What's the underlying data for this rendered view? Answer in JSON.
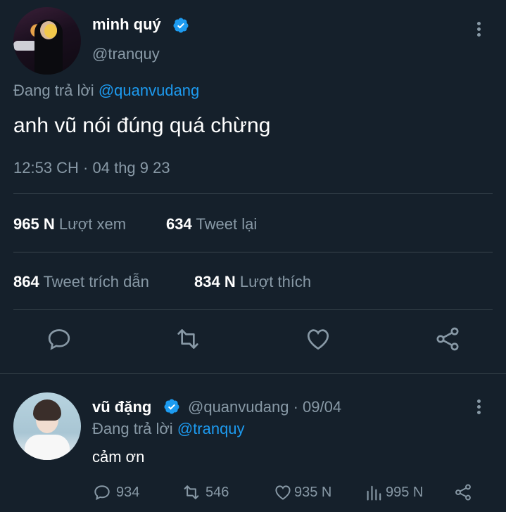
{
  "main_tweet": {
    "author_name": "minh quý",
    "author_handle": "@tranquy",
    "reply_prefix": "Đang trả lời",
    "reply_to": "@quanvudang",
    "text": "anh vũ nói đúng quá chừng",
    "timestamp": "12:53 CH · 04 thg 9 23",
    "stats": {
      "views_value": "965 N",
      "views_label": "Lượt xem",
      "retweets_value": "634",
      "retweets_label": "Tweet lại",
      "quotes_value": "864",
      "quotes_label": "Tweet trích dẫn",
      "likes_value": "834 N",
      "likes_label": "Lượt thích"
    },
    "actions": [
      "reply-icon",
      "retweet-icon",
      "like-icon",
      "share-icon"
    ]
  },
  "reply_tweet": {
    "author_name": "vũ đặng",
    "author_handle_date": "@quanvudang · 09/04",
    "reply_prefix": "Đang trả lời",
    "reply_to": "@tranquy",
    "text": "cảm ơn",
    "actions": {
      "replies": "934",
      "retweets": "546",
      "likes": "935 N",
      "views": "995 N"
    }
  },
  "colors": {
    "background": "#15202b",
    "muted": "#8899a6",
    "accent": "#1d9bf0",
    "divider": "#38444d"
  }
}
